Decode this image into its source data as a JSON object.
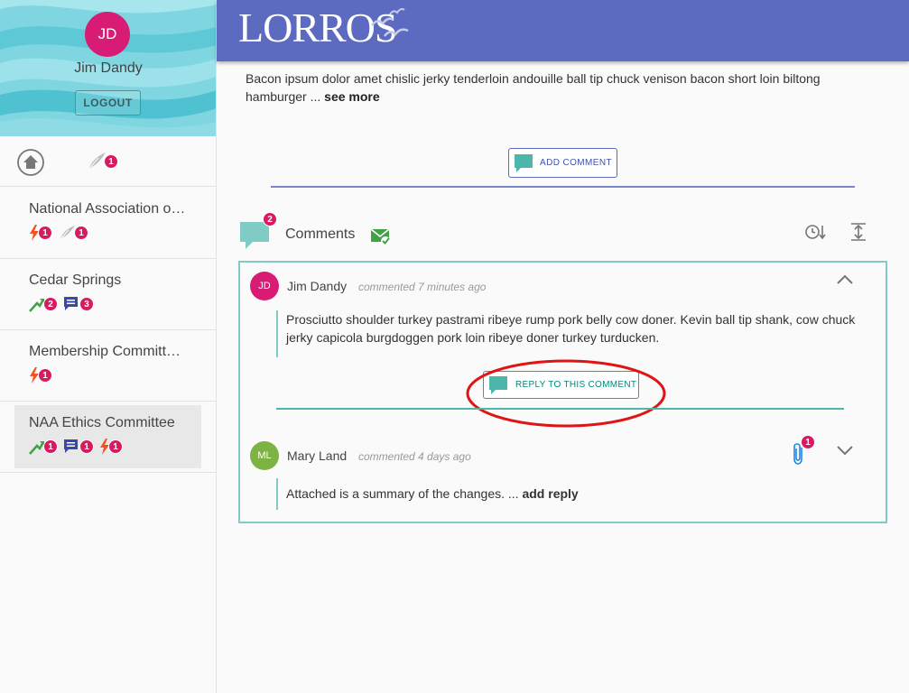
{
  "user": {
    "initials": "JD",
    "name": "Jim Dandy",
    "logout_label": "LOGOUT"
  },
  "top_icons": {
    "feather_count": "1"
  },
  "nav": [
    {
      "label": "National Association o…",
      "badges": [
        "1",
        "1"
      ]
    },
    {
      "label": "Cedar Springs",
      "badges": [
        "2",
        "3"
      ]
    },
    {
      "label": "Membership Committ…",
      "badges": [
        "1"
      ]
    },
    {
      "label": "NAA Ethics Committee",
      "badges": [
        "1",
        "1",
        "1"
      ]
    }
  ],
  "header": {
    "logo": "LORROS"
  },
  "intro": {
    "text": "Bacon ipsum dolor amet chislic jerky tenderloin andouille ball tip chuck venison bacon short loin biltong hamburger ...",
    "see_more": "see more"
  },
  "add_comment_label": "ADD COMMENT",
  "comments": {
    "title": "Comments",
    "count": "2",
    "items": [
      {
        "initials": "JD",
        "author": "Jim Dandy",
        "meta": "commented 7 minutes ago",
        "text": "Prosciutto shoulder turkey pastrami ribeye rump pork belly cow doner. Kevin ball tip shank, cow chuck jerky capicola burgdoggen pork loin ribeye doner turkey turducken.",
        "reply_label": "REPLY TO THIS COMMENT"
      },
      {
        "initials": "ML",
        "author": "Mary Land",
        "meta": "commented 4 days ago",
        "text": "Attached is a summary of the changes. ...",
        "add_reply": "add reply",
        "attachment_count": "1"
      }
    ]
  },
  "colors": {
    "header": "#5c6bc0",
    "teal": "#80cbc4",
    "badge": "#d81b60",
    "avatar_jd": "#d81b75",
    "avatar_ml": "#7cb342",
    "highlight": "#e01414"
  }
}
